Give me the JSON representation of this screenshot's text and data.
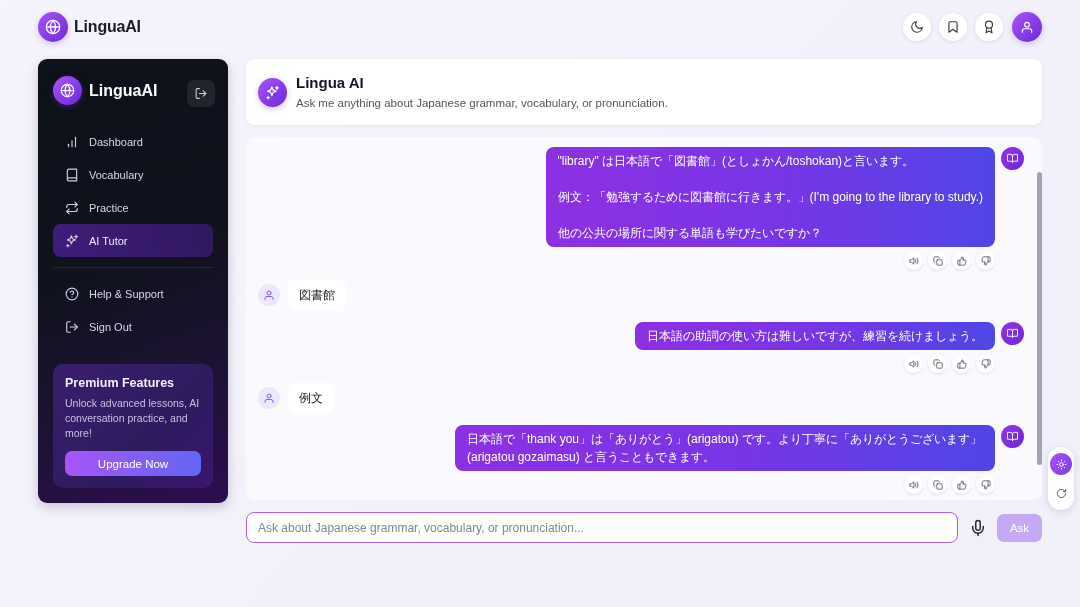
{
  "top_bar": {
    "brand": "LinguaAI"
  },
  "sidebar": {
    "brand": "LinguaAI",
    "nav": [
      {
        "label": "Dashboard",
        "selected": false
      },
      {
        "label": "Vocabulary",
        "selected": false
      },
      {
        "label": "Practice",
        "selected": false
      },
      {
        "label": "AI Tutor",
        "selected": true
      }
    ],
    "links": [
      "Help & Support",
      "Sign Out"
    ],
    "premium": {
      "title": "Premium Features",
      "description": "Unlock advanced lessons, AI conversation practice, and more!",
      "button": "Upgrade Now"
    }
  },
  "chat_header": {
    "title": "Lingua AI",
    "subtitle": "Ask me anything about Japanese grammar, vocabulary, or pronunciation."
  },
  "messages": [
    {
      "kind": "assistant",
      "paragraphs": [
        "\"library\" は日本語で「図書館」(としょかん/toshokan)と言います。",
        "例文：「勉強するために図書館に行きます。」(I'm going to the library to study.)",
        "他の公共の場所に関する単語も学びたいですか？"
      ]
    },
    {
      "kind": "user",
      "paragraphs": [
        "図書館"
      ]
    },
    {
      "kind": "assistant",
      "paragraphs": [
        "日本語の助詞の使い方は難しいですが、練習を続けましょう。"
      ]
    },
    {
      "kind": "user",
      "paragraphs": [
        "例文"
      ]
    },
    {
      "kind": "assistant",
      "paragraphs": [
        "日本語で「thank you」は「ありがとう」(arigatou) です。より丁寧に「ありがとうございます」 (arigatou gozaimasu) と言うこともできます。"
      ]
    }
  ],
  "composer": {
    "placeholder": "Ask about Japanese grammar, vocabulary, or pronunciation...",
    "ask_button": {
      "label": "Ask",
      "disabled": true
    }
  },
  "floating_tools": [
    {
      "selected": true
    },
    {
      "selected": false
    }
  ]
}
